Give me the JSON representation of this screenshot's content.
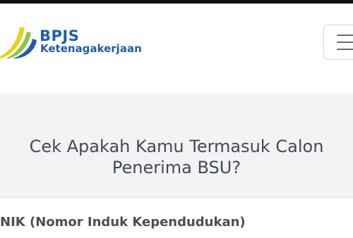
{
  "header": {
    "brand_name": "BPJS",
    "brand_sub": "Ketenagakerjaan",
    "logo_icon": "bpjs-ketenagakerjaan-logo-icon",
    "menu_icon": "hamburger-menu-icon"
  },
  "form": {
    "title_line1": "Cek Apakah Kamu Termasuk Calon",
    "title_line2": "Penerima BSU?",
    "nik_label": "NIK (Nomor Induk Kependudukan)"
  },
  "colors": {
    "brand_blue": "#1f5da8",
    "logo_green": "#8dc63f",
    "logo_yellow": "#e8d21d",
    "section_bg": "#f2f3f5",
    "text_gray": "#444a52"
  }
}
